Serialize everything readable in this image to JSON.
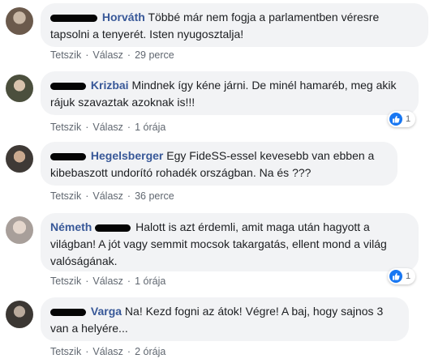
{
  "comments": [
    {
      "name": "Horváth",
      "text_line1": "Többé már nem fogja a parlamentben véresre",
      "text_line2": "tapsolni a tenyerét. Isten nyugosztalja!",
      "like": "Tetszik",
      "reply": "Válasz",
      "time": "29 perce"
    },
    {
      "name": "Krizbai",
      "text_line1": "Mindnek így kéne járni. De minél hamaréb, meg akik",
      "text_line2": "rájuk szavaztak azoknak is!!!",
      "like": "Tetszik",
      "reply": "Válasz",
      "time": "1 órája",
      "reaction_count": "1"
    },
    {
      "name": "Hegelsberger",
      "text_line1": "Egy FideSS-essel kevesebb van ebben a",
      "text_line2": "kibebaszott undorító rohadék országban. Na és ???",
      "like": "Tetszik",
      "reply": "Válasz",
      "time": "36 perce"
    },
    {
      "name": "Németh",
      "text_line1": "Halott is azt érdemli, amit maga után hagyott a",
      "text_line2": "világban! A jót vagy semmit mocsok takargatás, ellent mond a világ",
      "text_line3": "valóságának.",
      "like": "Tetszik",
      "reply": "Válasz",
      "time": "1 órája",
      "reaction_count": "1"
    },
    {
      "name": "Varga",
      "text_line1": "Na! Kezd fogni az átok! Végre! A baj, hogy sajnos 3",
      "text_line2": "van a helyére...",
      "like": "Tetszik",
      "reply": "Válasz",
      "time": "2 órája"
    }
  ],
  "separator": "·",
  "icons": {
    "avatar": "profile-photo",
    "like": "thumbs-up-icon"
  },
  "colors": {
    "bubble": "#f2f3f5",
    "name": "#385898",
    "like_blue": "#1877f2"
  }
}
